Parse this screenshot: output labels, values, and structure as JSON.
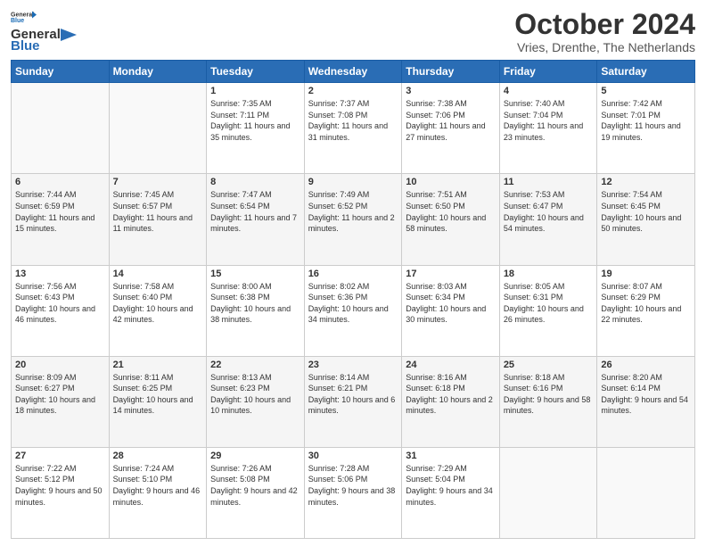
{
  "header": {
    "logo_general": "General",
    "logo_blue": "Blue",
    "title": "October 2024",
    "location": "Vries, Drenthe, The Netherlands"
  },
  "days_of_week": [
    "Sunday",
    "Monday",
    "Tuesday",
    "Wednesday",
    "Thursday",
    "Friday",
    "Saturday"
  ],
  "weeks": [
    [
      {
        "day": "",
        "sunrise": "",
        "sunset": "",
        "daylight": ""
      },
      {
        "day": "",
        "sunrise": "",
        "sunset": "",
        "daylight": ""
      },
      {
        "day": "1",
        "sunrise": "Sunrise: 7:35 AM",
        "sunset": "Sunset: 7:11 PM",
        "daylight": "Daylight: 11 hours and 35 minutes."
      },
      {
        "day": "2",
        "sunrise": "Sunrise: 7:37 AM",
        "sunset": "Sunset: 7:08 PM",
        "daylight": "Daylight: 11 hours and 31 minutes."
      },
      {
        "day": "3",
        "sunrise": "Sunrise: 7:38 AM",
        "sunset": "Sunset: 7:06 PM",
        "daylight": "Daylight: 11 hours and 27 minutes."
      },
      {
        "day": "4",
        "sunrise": "Sunrise: 7:40 AM",
        "sunset": "Sunset: 7:04 PM",
        "daylight": "Daylight: 11 hours and 23 minutes."
      },
      {
        "day": "5",
        "sunrise": "Sunrise: 7:42 AM",
        "sunset": "Sunset: 7:01 PM",
        "daylight": "Daylight: 11 hours and 19 minutes."
      }
    ],
    [
      {
        "day": "6",
        "sunrise": "Sunrise: 7:44 AM",
        "sunset": "Sunset: 6:59 PM",
        "daylight": "Daylight: 11 hours and 15 minutes."
      },
      {
        "day": "7",
        "sunrise": "Sunrise: 7:45 AM",
        "sunset": "Sunset: 6:57 PM",
        "daylight": "Daylight: 11 hours and 11 minutes."
      },
      {
        "day": "8",
        "sunrise": "Sunrise: 7:47 AM",
        "sunset": "Sunset: 6:54 PM",
        "daylight": "Daylight: 11 hours and 7 minutes."
      },
      {
        "day": "9",
        "sunrise": "Sunrise: 7:49 AM",
        "sunset": "Sunset: 6:52 PM",
        "daylight": "Daylight: 11 hours and 2 minutes."
      },
      {
        "day": "10",
        "sunrise": "Sunrise: 7:51 AM",
        "sunset": "Sunset: 6:50 PM",
        "daylight": "Daylight: 10 hours and 58 minutes."
      },
      {
        "day": "11",
        "sunrise": "Sunrise: 7:53 AM",
        "sunset": "Sunset: 6:47 PM",
        "daylight": "Daylight: 10 hours and 54 minutes."
      },
      {
        "day": "12",
        "sunrise": "Sunrise: 7:54 AM",
        "sunset": "Sunset: 6:45 PM",
        "daylight": "Daylight: 10 hours and 50 minutes."
      }
    ],
    [
      {
        "day": "13",
        "sunrise": "Sunrise: 7:56 AM",
        "sunset": "Sunset: 6:43 PM",
        "daylight": "Daylight: 10 hours and 46 minutes."
      },
      {
        "day": "14",
        "sunrise": "Sunrise: 7:58 AM",
        "sunset": "Sunset: 6:40 PM",
        "daylight": "Daylight: 10 hours and 42 minutes."
      },
      {
        "day": "15",
        "sunrise": "Sunrise: 8:00 AM",
        "sunset": "Sunset: 6:38 PM",
        "daylight": "Daylight: 10 hours and 38 minutes."
      },
      {
        "day": "16",
        "sunrise": "Sunrise: 8:02 AM",
        "sunset": "Sunset: 6:36 PM",
        "daylight": "Daylight: 10 hours and 34 minutes."
      },
      {
        "day": "17",
        "sunrise": "Sunrise: 8:03 AM",
        "sunset": "Sunset: 6:34 PM",
        "daylight": "Daylight: 10 hours and 30 minutes."
      },
      {
        "day": "18",
        "sunrise": "Sunrise: 8:05 AM",
        "sunset": "Sunset: 6:31 PM",
        "daylight": "Daylight: 10 hours and 26 minutes."
      },
      {
        "day": "19",
        "sunrise": "Sunrise: 8:07 AM",
        "sunset": "Sunset: 6:29 PM",
        "daylight": "Daylight: 10 hours and 22 minutes."
      }
    ],
    [
      {
        "day": "20",
        "sunrise": "Sunrise: 8:09 AM",
        "sunset": "Sunset: 6:27 PM",
        "daylight": "Daylight: 10 hours and 18 minutes."
      },
      {
        "day": "21",
        "sunrise": "Sunrise: 8:11 AM",
        "sunset": "Sunset: 6:25 PM",
        "daylight": "Daylight: 10 hours and 14 minutes."
      },
      {
        "day": "22",
        "sunrise": "Sunrise: 8:13 AM",
        "sunset": "Sunset: 6:23 PM",
        "daylight": "Daylight: 10 hours and 10 minutes."
      },
      {
        "day": "23",
        "sunrise": "Sunrise: 8:14 AM",
        "sunset": "Sunset: 6:21 PM",
        "daylight": "Daylight: 10 hours and 6 minutes."
      },
      {
        "day": "24",
        "sunrise": "Sunrise: 8:16 AM",
        "sunset": "Sunset: 6:18 PM",
        "daylight": "Daylight: 10 hours and 2 minutes."
      },
      {
        "day": "25",
        "sunrise": "Sunrise: 8:18 AM",
        "sunset": "Sunset: 6:16 PM",
        "daylight": "Daylight: 9 hours and 58 minutes."
      },
      {
        "day": "26",
        "sunrise": "Sunrise: 8:20 AM",
        "sunset": "Sunset: 6:14 PM",
        "daylight": "Daylight: 9 hours and 54 minutes."
      }
    ],
    [
      {
        "day": "27",
        "sunrise": "Sunrise: 7:22 AM",
        "sunset": "Sunset: 5:12 PM",
        "daylight": "Daylight: 9 hours and 50 minutes."
      },
      {
        "day": "28",
        "sunrise": "Sunrise: 7:24 AM",
        "sunset": "Sunset: 5:10 PM",
        "daylight": "Daylight: 9 hours and 46 minutes."
      },
      {
        "day": "29",
        "sunrise": "Sunrise: 7:26 AM",
        "sunset": "Sunset: 5:08 PM",
        "daylight": "Daylight: 9 hours and 42 minutes."
      },
      {
        "day": "30",
        "sunrise": "Sunrise: 7:28 AM",
        "sunset": "Sunset: 5:06 PM",
        "daylight": "Daylight: 9 hours and 38 minutes."
      },
      {
        "day": "31",
        "sunrise": "Sunrise: 7:29 AM",
        "sunset": "Sunset: 5:04 PM",
        "daylight": "Daylight: 9 hours and 34 minutes."
      },
      {
        "day": "",
        "sunrise": "",
        "sunset": "",
        "daylight": ""
      },
      {
        "day": "",
        "sunrise": "",
        "sunset": "",
        "daylight": ""
      }
    ]
  ]
}
